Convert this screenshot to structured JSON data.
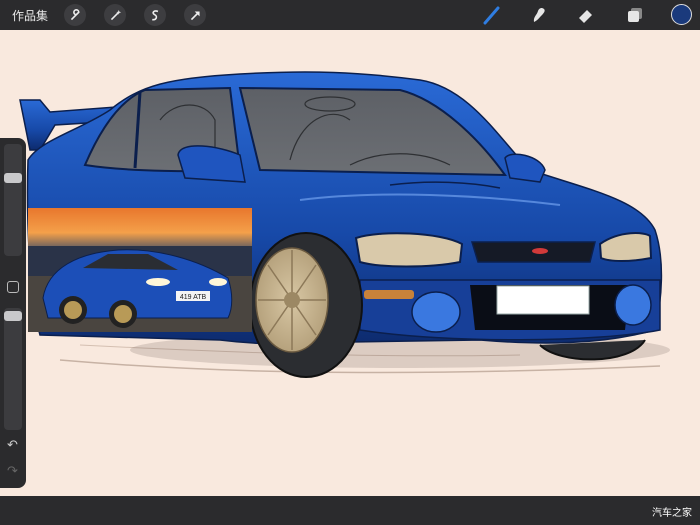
{
  "topbar": {
    "gallery_label": "作品集",
    "left_tools": [
      "wrench-icon",
      "magic-wand-icon",
      "selection-icon",
      "transform-arrow-icon"
    ],
    "right_tools": [
      "brush-icon",
      "smudge-icon",
      "eraser-icon",
      "layers-icon"
    ],
    "active_tool": "brush-icon",
    "current_color": "#1a3a7c"
  },
  "sidebar": {
    "brush_size_fraction": 0.28,
    "opacity_fraction": 0.03,
    "undo_label": "↶",
    "redo_label": "↷"
  },
  "reference_photo": {
    "plate_text": "419 ATB"
  },
  "watermark": "汽车之家"
}
